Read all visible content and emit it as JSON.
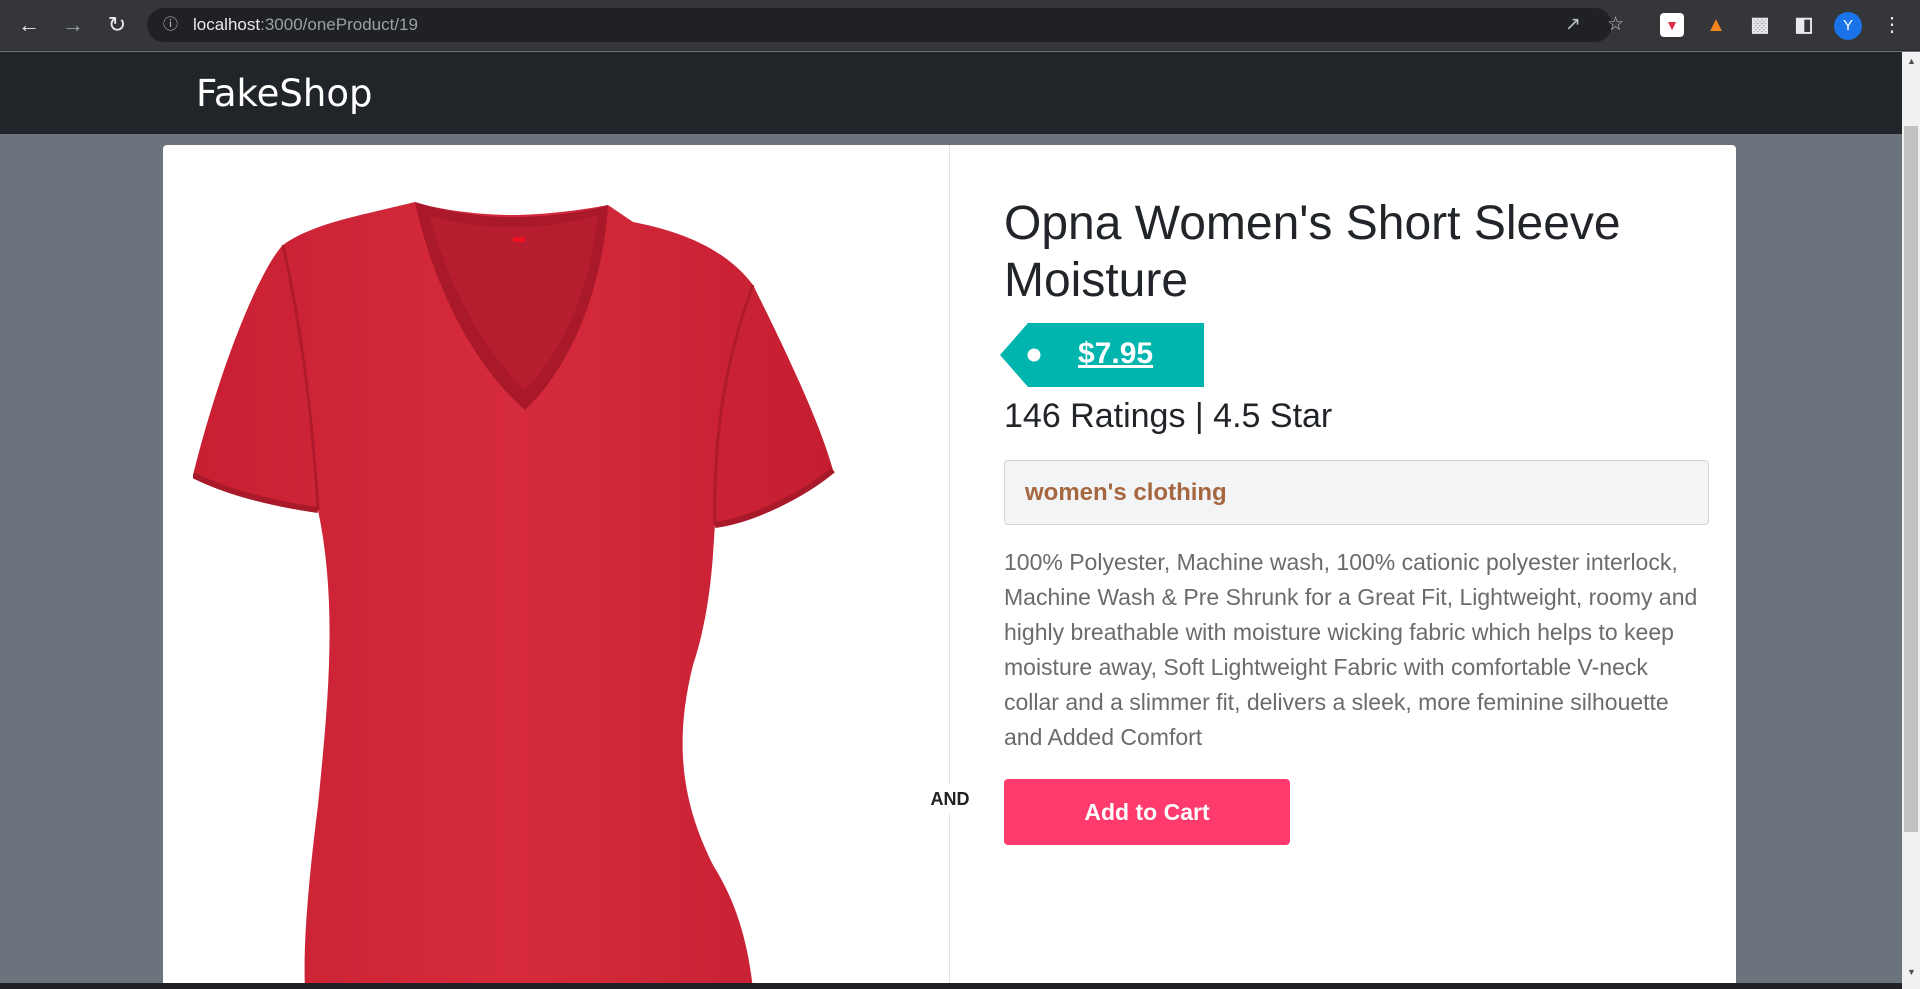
{
  "browser": {
    "url_host": "localhost",
    "url_rest": ":3000/oneProduct/19",
    "avatar_letter": "Y"
  },
  "icons": {
    "back": "back-arrow-icon",
    "forward": "forward-arrow-icon",
    "reload": "reload-icon",
    "info": "info-icon",
    "share": "share-icon",
    "star": "bookmark-star-icon",
    "pocket": "pocket-extension-icon",
    "fox": "metamask-fox-icon",
    "puzzle": "extensions-puzzle-icon",
    "side_panel": "side-panel-icon",
    "menu": "kebab-menu-icon"
  },
  "header": {
    "brand": "FakeShop"
  },
  "product": {
    "title": "Opna Women's Short Sleeve Moisture",
    "price": "$7.95",
    "ratings": "146 Ratings | 4.5 Star",
    "category": "women's clothing",
    "description": "100% Polyester, Machine wash, 100% cationic polyester interlock, Machine Wash & Pre Shrunk for a Great Fit, Lightweight, roomy and highly breathable with moisture wicking fabric which helps to keep moisture away, Soft Lightweight Fabric with comfortable V-neck collar and a slimmer fit, delivers a sleek, more feminine silhouette and Added Comfort",
    "divider_label": "AND",
    "add_to_cart": "Add to Cart"
  },
  "colors": {
    "header_bg": "#212529",
    "page_bg": "#6b737c",
    "price_tag": "#00b5ad",
    "category_text": "#a5673f",
    "cart_button": "#ff3a6c",
    "shirt": "#d42a3c"
  }
}
